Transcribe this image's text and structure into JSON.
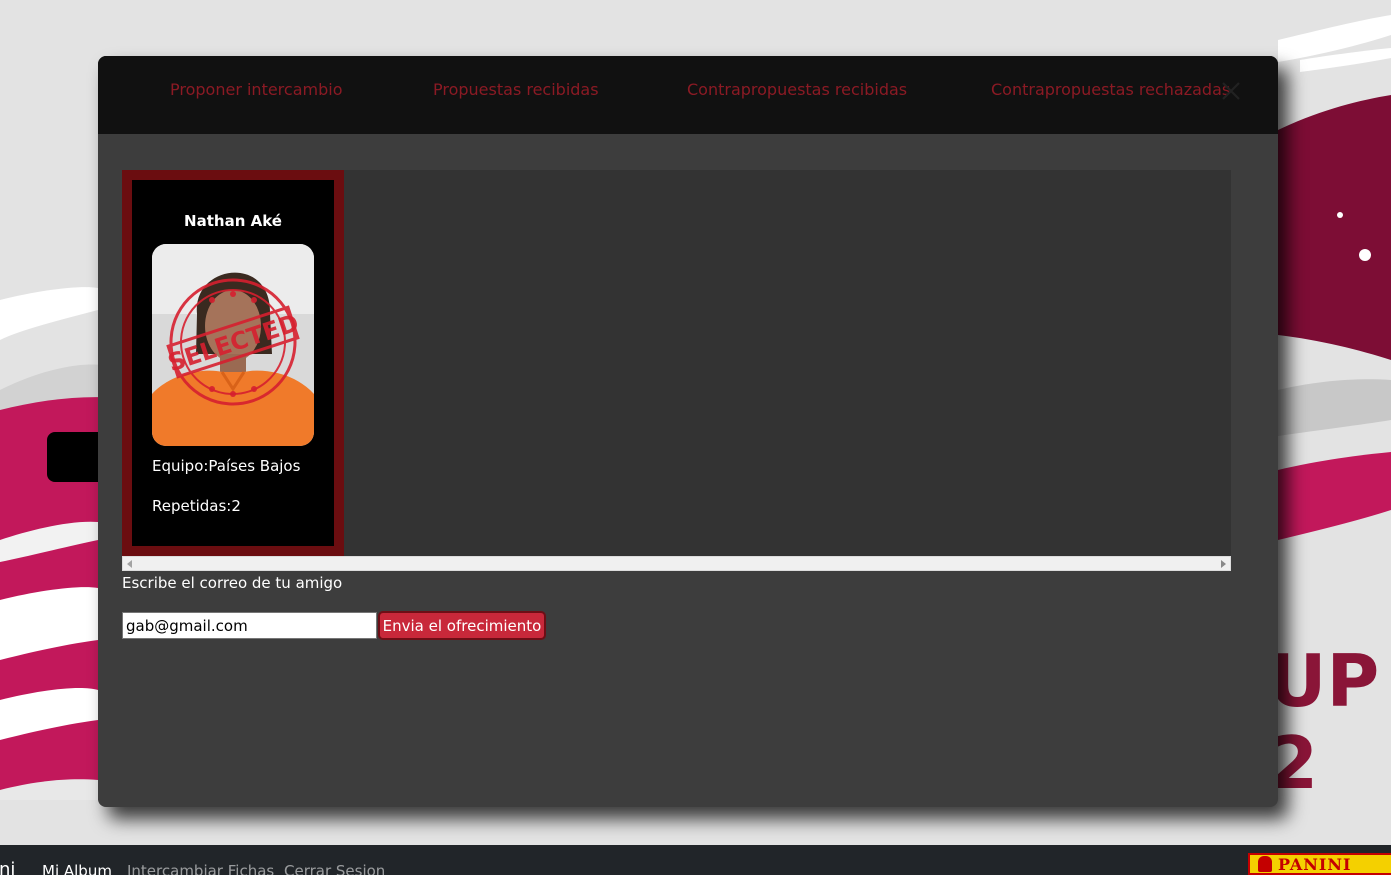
{
  "modal": {
    "tabs": [
      {
        "label": "Proponer intercambio"
      },
      {
        "label": "Propuestas recibidas"
      },
      {
        "label": "Contrapropuestas recibidas"
      },
      {
        "label": "Contrapropuestas rechazadas"
      }
    ],
    "close_icon": "close-icon",
    "card": {
      "name": "Nathan Aké",
      "team": "Equipo:Países Bajos",
      "repeated": "Repetidas:2",
      "stamp_text": "SELECTED"
    },
    "email_label": "Escribe el correo de tu amigo",
    "email_value": "gab@gmail.com",
    "send_label": "Envia el ofrecimiento"
  },
  "navbar": {
    "brand": "ini",
    "links": [
      {
        "label": "Mi Album",
        "active": true
      },
      {
        "label": "Intercambiar Fichas",
        "active": false
      },
      {
        "label": "Cerrar Sesion",
        "active": false
      }
    ],
    "logo_text": "PANINI"
  },
  "background": {
    "wc_line1": "UP",
    "wc_line2": "2"
  },
  "colors": {
    "tab_text": "#8b1a24",
    "send_button": "#c8283a",
    "card_frame": "#6b0d10",
    "accent_pink": "#c2185b",
    "accent_maroon": "#8a1538"
  }
}
